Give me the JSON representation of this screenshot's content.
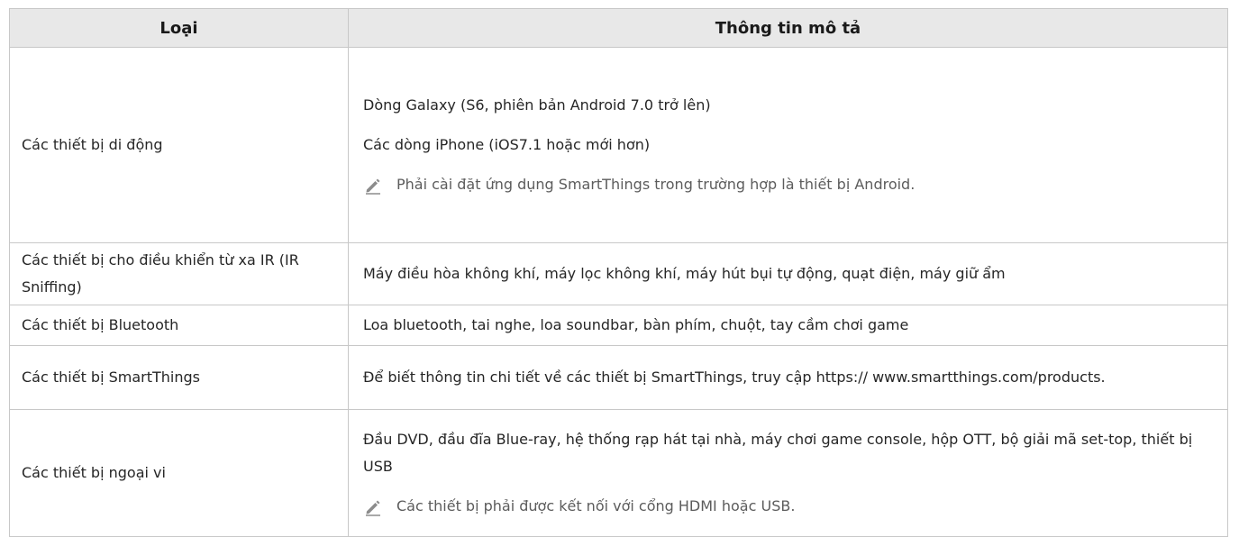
{
  "table": {
    "headers": {
      "type": "Loại",
      "description": "Thông tin mô tả"
    },
    "rows": [
      {
        "type": "Các thiết bị di động",
        "lines": [
          "Dòng Galaxy (S6, phiên bản Android 7.0 trở lên)",
          "Các dòng iPhone (iOS7.1 hoặc mới hơn)"
        ],
        "note": "Phải cài đặt ứng dụng SmartThings trong trường hợp là thiết bị Android."
      },
      {
        "type": "Các thiết bị cho điều khiển từ xa IR (IR Sniffing)",
        "lines": [
          "Máy điều hòa không khí, máy lọc không khí, máy hút bụi tự động, quạt điện, máy giữ ẩm"
        ]
      },
      {
        "type": "Các thiết bị Bluetooth",
        "lines": [
          "Loa bluetooth, tai nghe, loa soundbar, bàn phím, chuột, tay cầm chơi game"
        ]
      },
      {
        "type": "Các thiết bị SmartThings",
        "lines": [
          "Để biết thông tin chi tiết về các thiết bị SmartThings, truy cập https:// www.smartthings.com/products."
        ]
      },
      {
        "type": "Các thiết bị ngoại vi",
        "lines": [
          "Đầu DVD, đầu đĩa Blue-ray, hệ thống rạp hát tại nhà, máy chơi game console, hộp OTT, bộ giải mã set-top, thiết bị USB"
        ],
        "note": "Các thiết bị phải được kết nối với cổng HDMI hoặc USB."
      }
    ]
  },
  "icons": {
    "note": "pencil-note-icon"
  },
  "colors": {
    "header_bg": "#e8e8e8",
    "border": "#c8c8c8",
    "note_text": "#5c5c5c"
  }
}
